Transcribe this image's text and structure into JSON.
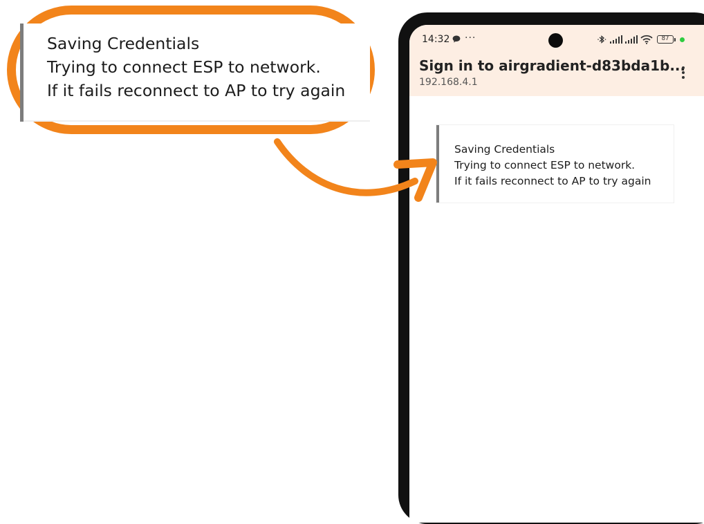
{
  "message": {
    "lines": [
      "Saving Credentials",
      "Trying to connect ESP to network.",
      "If it fails reconnect to AP to try again"
    ]
  },
  "status_bar": {
    "time": "14:32",
    "more": "···",
    "battery_level": "87"
  },
  "header": {
    "title": "Sign in to airgradient-d83bda1b...",
    "url": "192.168.4.1"
  },
  "icons": {
    "chat": "chat-bubble-icon",
    "bluetooth": "bluetooth-icon",
    "signal": "cellular-signal-icon",
    "wifi": "wifi-icon",
    "battery": "battery-icon",
    "menu": "overflow-menu-icon",
    "arrow": "curved-arrow-icon"
  },
  "colors": {
    "accent_orange": "#f2841b",
    "header_background": "#fdeee3",
    "card_border": "#7d7d7d",
    "status_dot": "#2ecc40"
  }
}
